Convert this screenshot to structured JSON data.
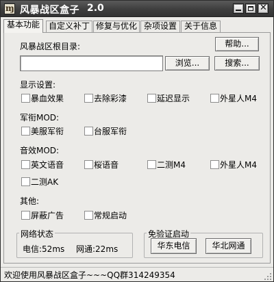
{
  "window": {
    "title": "风暴战区盒子",
    "version": "2.0",
    "icon": "app-logo-icon"
  },
  "tabs": [
    "基本功能",
    "自定义补丁",
    "修复与优化",
    "杂项设置",
    "关于信息"
  ],
  "root_dir": {
    "label": "风暴战区根目录:",
    "value": "",
    "help_button": "帮助...",
    "browse_button": "浏览...",
    "search_button": "搜索..."
  },
  "display_settings": {
    "title": "显示设置:",
    "options": [
      "暴血效果",
      "去除彩漆",
      "延迟显示",
      "外星人M4"
    ]
  },
  "military_mod": {
    "title": "军衔MOD:",
    "options": [
      "美服军衔",
      "台服军衔"
    ]
  },
  "sound_mod": {
    "title": "音效MOD:",
    "options": [
      "英文语音",
      "桜语音",
      "二测M4",
      "外星人M4",
      "二测AK"
    ]
  },
  "other": {
    "title": "其他:",
    "options": [
      "屏蔽广告",
      "常规启动"
    ]
  },
  "network": {
    "title": "网络状态",
    "telecom": "电信:52ms",
    "netcom": "网通:22ms"
  },
  "launch": {
    "title": "免验证启动",
    "east_button": "华东电信",
    "north_button": "华北网通"
  },
  "status_bar": {
    "text": "欢迎使用风暴战区盒子~~~QQ群314249354"
  },
  "colors": {
    "titlebar": "#3e3e3e",
    "window_bg": "#ecebe8"
  }
}
